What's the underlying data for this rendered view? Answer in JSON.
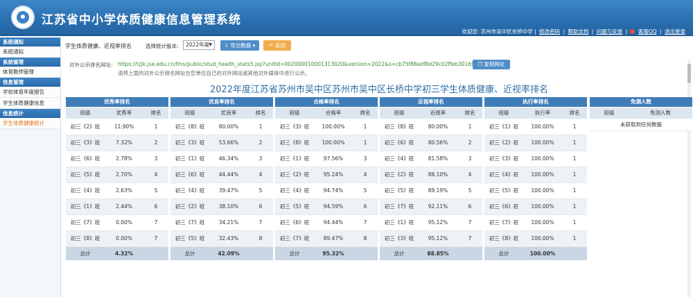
{
  "header": {
    "title": "江苏省中小学体质健康信息管理系统",
    "welcome": "欢迎您: 苏州市吴中区长桥中学 |",
    "links": [
      "修改密码",
      "帮助文档",
      "问题与反馈",
      "客服QQ",
      "退出登录"
    ],
    "separator": "|"
  },
  "sidebar": {
    "groups": [
      {
        "title": "系统通知",
        "items": [
          {
            "label": "系统通知",
            "active": false
          }
        ]
      },
      {
        "title": "系统管理",
        "items": [
          {
            "label": "体育教师管理",
            "active": false
          }
        ]
      },
      {
        "title": "信息管理",
        "items": [
          {
            "label": "学校体育年度报告",
            "active": false
          },
          {
            "label": "学生体质健康信息",
            "active": false
          }
        ]
      },
      {
        "title": "信息统计",
        "items": [
          {
            "label": "学生体质健康统计",
            "active": true
          }
        ]
      }
    ]
  },
  "toolbar": {
    "page_name": "学生体质健康、近视率排名",
    "version_label": "选择统计版本:",
    "version_value": "2022年度",
    "export_label": "⇩ 导出数据 ▾",
    "back_label": "↶ 返回"
  },
  "public_url": {
    "label": "对外公示排名网址:",
    "url": "https://tzjk.jse.edu.cn/fms/public/stud_health_stats5.jsp?unitId=002000010001313020&version=2022&s=cb75f88adf8d29c02ffeb301695ae519",
    "copy_label": "❐ 复制网址",
    "hint": "请将上面的对外公示排名网址在您单位自己的对外网站或其他对外媒体中进行公示。"
  },
  "main_title": "2022年度江苏省苏州市吴中区苏州市吴中区长桥中学初三学生体质健康、近视率排名",
  "tables": [
    {
      "title": "优秀率排名",
      "cols": [
        "班级",
        "优秀率",
        "排名"
      ],
      "rows": [
        [
          "初三《2》班",
          "11.90%",
          "1"
        ],
        [
          "初三《3》班",
          "7.32%",
          "2"
        ],
        [
          "初三《6》班",
          "2.78%",
          "3"
        ],
        [
          "初三《5》班",
          "2.70%",
          "4"
        ],
        [
          "初三《4》班",
          "2.63%",
          "5"
        ],
        [
          "初三《1》班",
          "2.44%",
          "6"
        ],
        [
          "初三《7》班",
          "0.00%",
          "7"
        ],
        [
          "初三《8》班",
          "0.00%",
          "7"
        ]
      ],
      "total_label": "总计",
      "total_value": "4.32%"
    },
    {
      "title": "优良率排名",
      "cols": [
        "班级",
        "优良率",
        "排名"
      ],
      "rows": [
        [
          "初三《8》班",
          "80.00%",
          "1"
        ],
        [
          "初三《3》班",
          "53.66%",
          "2"
        ],
        [
          "初三《1》班",
          "46.34%",
          "3"
        ],
        [
          "初三《6》班",
          "44.44%",
          "4"
        ],
        [
          "初三《4》班",
          "39.47%",
          "5"
        ],
        [
          "初三《2》班",
          "38.10%",
          "6"
        ],
        [
          "初三《7》班",
          "34.21%",
          "7"
        ],
        [
          "初三《5》班",
          "32.43%",
          "8"
        ]
      ],
      "total_label": "总计",
      "total_value": "42.09%"
    },
    {
      "title": "合格率排名",
      "cols": [
        "班级",
        "合格率",
        "排名"
      ],
      "rows": [
        [
          "初三《3》班",
          "100.00%",
          "1"
        ],
        [
          "初三《8》班",
          "100.00%",
          "1"
        ],
        [
          "初三《1》班",
          "97.56%",
          "3"
        ],
        [
          "初三《2》班",
          "95.24%",
          "4"
        ],
        [
          "初三《4》班",
          "94.74%",
          "5"
        ],
        [
          "初三《5》班",
          "94.59%",
          "6"
        ],
        [
          "初三《6》班",
          "94.44%",
          "7"
        ],
        [
          "初三《7》班",
          "89.47%",
          "8"
        ]
      ],
      "total_label": "总计",
      "total_value": "95.32%"
    },
    {
      "title": "近视率排名",
      "cols": [
        "班级",
        "近视率",
        "排名"
      ],
      "rows": [
        [
          "初三《8》班",
          "80.00%",
          "1"
        ],
        [
          "初三《6》班",
          "80.56%",
          "2"
        ],
        [
          "初三《4》班",
          "81.58%",
          "3"
        ],
        [
          "初三《2》班",
          "88.10%",
          "4"
        ],
        [
          "初三《5》班",
          "89.19%",
          "5"
        ],
        [
          "初三《7》班",
          "92.11%",
          "6"
        ],
        [
          "初三《1》班",
          "95.12%",
          "7"
        ],
        [
          "初三《3》班",
          "95.12%",
          "7"
        ]
      ],
      "total_label": "总计",
      "total_value": "88.85%"
    },
    {
      "title": "执行率排名",
      "cols": [
        "班级",
        "执行率",
        "排名"
      ],
      "rows": [
        [
          "初三《1》班",
          "100.00%",
          "1"
        ],
        [
          "初三《2》班",
          "100.00%",
          "1"
        ],
        [
          "初三《3》班",
          "100.00%",
          "1"
        ],
        [
          "初三《4》班",
          "100.00%",
          "1"
        ],
        [
          "初三《5》班",
          "100.00%",
          "1"
        ],
        [
          "初三《6》班",
          "100.00%",
          "1"
        ],
        [
          "初三《7》班",
          "100.00%",
          "1"
        ],
        [
          "初三《8》班",
          "100.00%",
          "1"
        ]
      ],
      "total_label": "总计",
      "total_value": "100.00%"
    }
  ],
  "exempt_table": {
    "title": "免测人数",
    "cols": [
      "班级",
      "免测人数"
    ],
    "empty_text": "未获取到任何数据"
  }
}
